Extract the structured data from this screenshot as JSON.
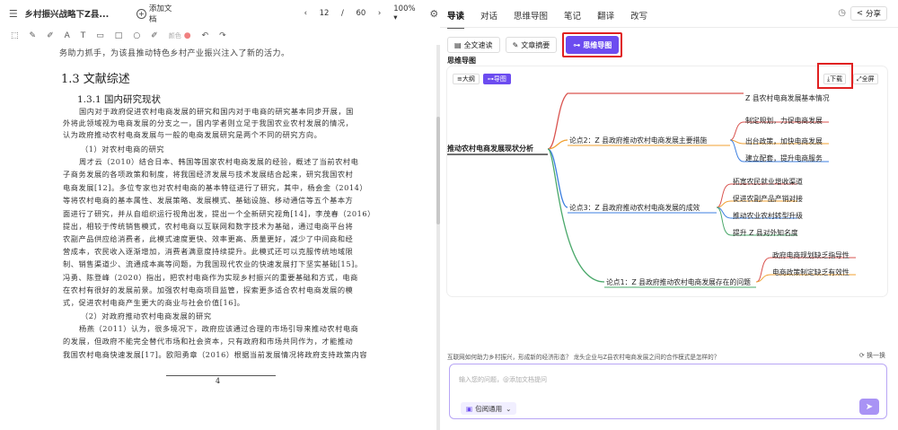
{
  "topbar": {
    "doc_title": "乡村振兴战略下Z县...",
    "add_doc": "添加文档",
    "page_current": "12",
    "page_total": "60",
    "zoom": "100%"
  },
  "toolbar2": {
    "color_label": "颜色"
  },
  "doc": {
    "cut_line": "务助力抓手，为该县推动特色乡村产业振兴注入了新的活力。",
    "h1": "1.3 文献综述",
    "h2": "1.3.1 国内研究现状",
    "lines": [
      "国内对于政府促进农村电商发展的研究和国内对于电商的研究基本同步开展，国",
      "外将此领域视为电商发展的分支之一，国内学者则立足于我国农业农村发展的情况，",
      "认为政府推动农村电商发展与一般的电商发展研究是两个不同的研究方向。",
      "（1）对农村电商的研究",
      "周才云（2010）结合日本、韩国等国家农村电商发展的经验，概述了当前农村电",
      "子商务发展的各项政策和制度，将我国经济发展与技术发展结合起来，研究我国农村",
      "电商发展[12]。多位专家也对农村电商的基本特征进行了研究，其中，杨会金（2014）",
      "等将农村电商的基本属性、发展策略、发展模式、基础设施、移动通信等五个基本方",
      "面进行了研究，并从自组织运行视角出发，提出一个全新研究视角[14]，李茂春（2016）",
      "提出，相较于传统销售模式，农村电商以互联网和数字技术为基础，通过电商平台将",
      "农副产品供应给消费者，此模式速度更快、效率更高、质量更好，减少了中间商和经",
      "营成本，农民收入逐渐增加，消费者满意度持续提升。此模式还可以克服传统地域限",
      "制、销售渠道少、流通成本高等问题，为我国现代农业的快速发展打下坚实基础[15]。",
      "冯勇、陈登峰（2020）指出，把农村电商作为实现乡村振兴的重要基础和方式，电商",
      "在农村有很好的发展前景。加强农村电商项目监管，探索更多适合农村电商发展的模",
      "式，促进农村电商产生更大的商业与社会价值[16]。",
      "（2）对政府推动农村电商发展的研究",
      "杨燕（2011）认为，很多境况下，政府应该通过合理的市场引导来推动农村电商",
      "的发展，但政府不能完全替代市场和社会资本，只有政府和市场共同作为，才能推动",
      "我国农村电商快速发展[17]。欧阳勇章（2016）根据当前发展情况将政府支持政策内容"
    ],
    "page_number": "4"
  },
  "right": {
    "tabs": [
      "导读",
      "对话",
      "思维导图",
      "笔记",
      "翻译",
      "改写"
    ],
    "share": "分享",
    "buttons": {
      "full_read": "全文速读",
      "summary": "文章摘要",
      "mindmap": "思维导图"
    },
    "mindmap_label": "思维导图",
    "view_outline": "大纲",
    "view_map": "导图",
    "download": "下载",
    "fullscreen": "全屏",
    "mindmap": {
      "root": "推动农村电商发展现状分析",
      "top_leaf": "Z 县农村电商发展基本情况",
      "branch2": "论点2：Z 县政府推动农村电商发展主要措施",
      "branch2_children": [
        "制定规划，力促电商发展",
        "出台政策，加快电商发展",
        "建立配套，提升电商服务"
      ],
      "branch3": "论点3：Z 县政府推动农村电商发展的成效",
      "branch3_children": [
        "拓宽农民就业增收渠道",
        "促进农副产品产销对接",
        "推动农业农村转型升级",
        "提升 Z 县对外知名度"
      ],
      "branch1": "论点1：Z 县政府推动农村电商发展存在的问题",
      "branch1_children": [
        "政府电商规划缺乏指导性",
        "电商政策制定缺乏有效性"
      ]
    },
    "question": "互联网如何助力乡村振兴，形成新的经济形态？ 龙头企业与Z县农村电商发展之间的合作模式是怎样的？",
    "swap": "换一换",
    "input_placeholder": "输入您的问题，@添加文档提问",
    "model": "包阅通用"
  },
  "colors": {
    "accent": "#6c4cf0",
    "highlight_box": "#e02020",
    "branch_red": "#d9534f",
    "branch_orange": "#f0a030",
    "branch_blue": "#3d7fe0",
    "branch_green": "#4aa86a"
  }
}
